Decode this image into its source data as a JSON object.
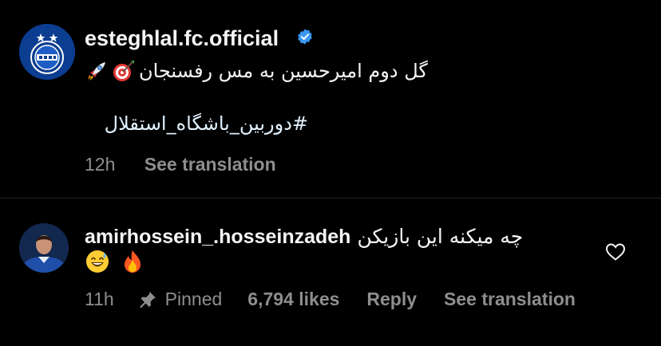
{
  "post": {
    "username": "esteghlal.fc.official",
    "verified": true,
    "caption_text": "گل دوم امیرحسین به مس رفسنجان",
    "caption_emojis": [
      "rocket-emoji",
      "direct-hit-emoji"
    ],
    "hashtag": "#دوربین_باشگاه_استقلال",
    "time": "12h",
    "see_translation": "See translation"
  },
  "comment": {
    "username": "amirhossein_.hosseinzadeh",
    "text": "چه میکنه این بازیکن",
    "emojis": [
      "grinning-sweat-emoji",
      "fire-emoji"
    ],
    "time": "11h",
    "pinned_label": "Pinned",
    "likes": "6,794 likes",
    "reply": "Reply",
    "see_translation": "See translation"
  },
  "colors": {
    "background": "#000000",
    "text_primary": "#f5f5f5",
    "text_secondary": "#8e8e8e",
    "verified_badge": "#3897f0",
    "divider": "#262626",
    "hashtag": "#e0f1ff"
  }
}
